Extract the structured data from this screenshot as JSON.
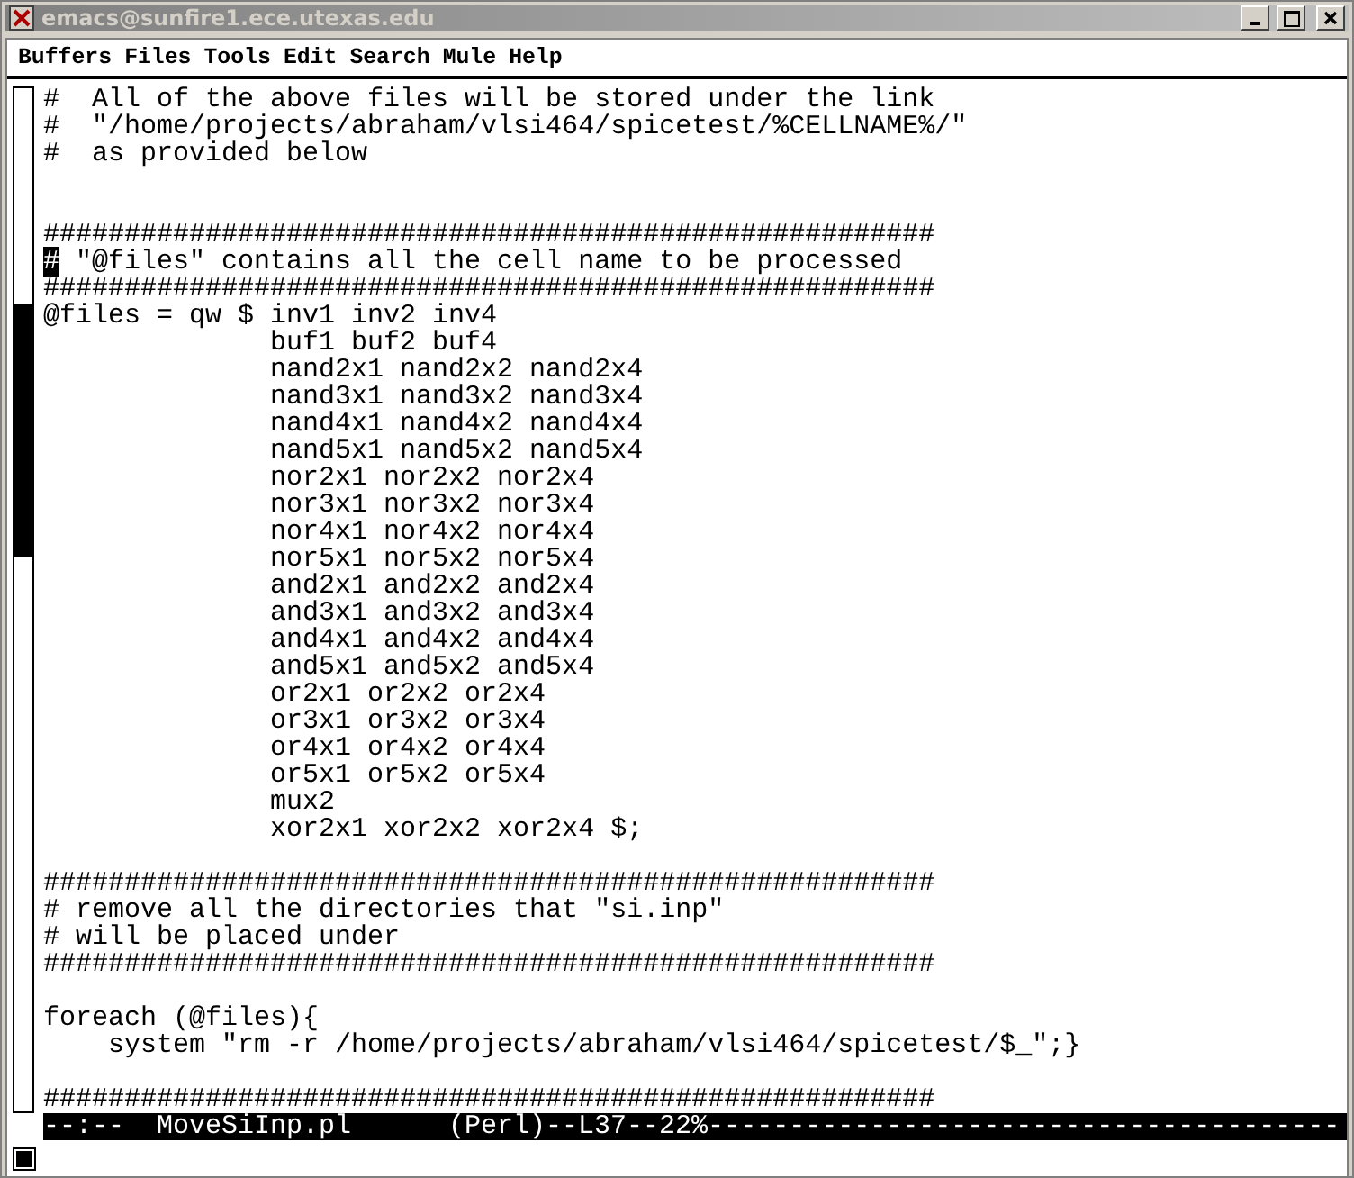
{
  "window": {
    "title": "emacs@sunfire1.ece.utexas.edu"
  },
  "menu": [
    "Buffers",
    "Files",
    "Tools",
    "Edit",
    "Search",
    "Mule",
    "Help"
  ],
  "lines": [
    {
      "kind": "code",
      "text": "#  All of the above files will be stored under the link",
      "cursor": false
    },
    {
      "kind": "code",
      "text": "#  \"/home/projects/abraham/vlsi464/spicetest/%CELLNAME%/\"",
      "cursor": false
    },
    {
      "kind": "code",
      "text": "#  as provided below",
      "cursor": false
    },
    {
      "kind": "blank"
    },
    {
      "kind": "blank"
    },
    {
      "kind": "code",
      "text": "#######################################################",
      "cursor": false
    },
    {
      "kind": "code",
      "text": "# \"@files\" contains all the cell name to be processed",
      "cursor": true
    },
    {
      "kind": "code",
      "text": "#######################################################",
      "cursor": false
    },
    {
      "kind": "code",
      "text": "@files = qw $ inv1 inv2 inv4",
      "cursor": false
    },
    {
      "kind": "code",
      "text": "              buf1 buf2 buf4",
      "cursor": false
    },
    {
      "kind": "code",
      "text": "              nand2x1 nand2x2 nand2x4",
      "cursor": false
    },
    {
      "kind": "code",
      "text": "              nand3x1 nand3x2 nand3x4",
      "cursor": false
    },
    {
      "kind": "code",
      "text": "              nand4x1 nand4x2 nand4x4",
      "cursor": false
    },
    {
      "kind": "code",
      "text": "              nand5x1 nand5x2 nand5x4",
      "cursor": false
    },
    {
      "kind": "code",
      "text": "              nor2x1 nor2x2 nor2x4",
      "cursor": false
    },
    {
      "kind": "code",
      "text": "              nor3x1 nor3x2 nor3x4",
      "cursor": false
    },
    {
      "kind": "code",
      "text": "              nor4x1 nor4x2 nor4x4",
      "cursor": false
    },
    {
      "kind": "code",
      "text": "              nor5x1 nor5x2 nor5x4",
      "cursor": false
    },
    {
      "kind": "code",
      "text": "              and2x1 and2x2 and2x4",
      "cursor": false
    },
    {
      "kind": "code",
      "text": "              and3x1 and3x2 and3x4",
      "cursor": false
    },
    {
      "kind": "code",
      "text": "              and4x1 and4x2 and4x4",
      "cursor": false
    },
    {
      "kind": "code",
      "text": "              and5x1 and5x2 and5x4",
      "cursor": false
    },
    {
      "kind": "code",
      "text": "              or2x1 or2x2 or2x4",
      "cursor": false
    },
    {
      "kind": "code",
      "text": "              or3x1 or3x2 or3x4",
      "cursor": false
    },
    {
      "kind": "code",
      "text": "              or4x1 or4x2 or4x4",
      "cursor": false
    },
    {
      "kind": "code",
      "text": "              or5x1 or5x2 or5x4",
      "cursor": false
    },
    {
      "kind": "code",
      "text": "              mux2",
      "cursor": false
    },
    {
      "kind": "code",
      "text": "              xor2x1 xor2x2 xor2x4 $;",
      "cursor": false
    },
    {
      "kind": "blank"
    },
    {
      "kind": "code",
      "text": "#######################################################",
      "cursor": false
    },
    {
      "kind": "code",
      "text": "# remove all the directories that \"si.inp\"",
      "cursor": false
    },
    {
      "kind": "code",
      "text": "# will be placed under",
      "cursor": false
    },
    {
      "kind": "code",
      "text": "#######################################################",
      "cursor": false
    },
    {
      "kind": "blank"
    },
    {
      "kind": "code",
      "text": "foreach (@files){",
      "cursor": false
    },
    {
      "kind": "code",
      "text": "    system \"rm -r /home/projects/abraham/vlsi464/spicetest/$_\";}",
      "cursor": false
    },
    {
      "kind": "blank"
    },
    {
      "kind": "code",
      "text": "#######################################################",
      "cursor": false
    }
  ],
  "mode_line": "--:--  MoveSiInp.pl      (Perl)--L37--22%---------------------------------------"
}
